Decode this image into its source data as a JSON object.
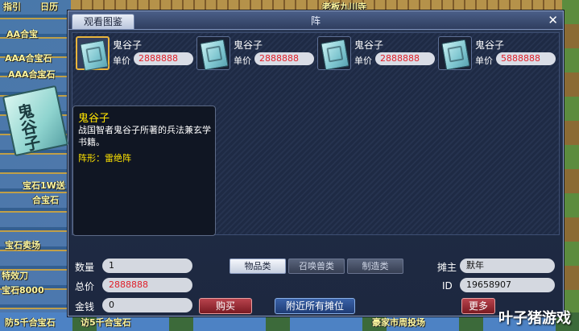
{
  "background": {
    "left_labels": [
      "指引",
      "日历",
      "AA合宝",
      "AAA合宝石",
      "AAA合宝石",
      "宝石1W送",
      "合宝石",
      "宝石卖场",
      "特效刀",
      "宝石8000",
      "防5千合宝石"
    ],
    "top_labels": [
      "老板九川寺"
    ],
    "bottom_labels": [
      "访5千合宝石",
      "豪家市周投场"
    ]
  },
  "window": {
    "tab_label": "观看图鉴",
    "title": "阵",
    "close_icon": "✕"
  },
  "items": [
    {
      "name": "鬼谷子",
      "price_label": "单价",
      "price": "2888888",
      "selected": true
    },
    {
      "name": "鬼谷子",
      "price_label": "单价",
      "price": "2888888",
      "selected": false
    },
    {
      "name": "鬼谷子",
      "price_label": "单价",
      "price": "2888888",
      "selected": false
    },
    {
      "name": "鬼谷子",
      "price_label": "单价",
      "price": "5888888",
      "selected": false
    }
  ],
  "tooltip": {
    "name": "鬼谷子",
    "description": "战国智者鬼谷子所著的兵法兼玄学书籍。",
    "formation": "阵形：雷绝阵",
    "icon_text": "鬼谷子"
  },
  "form": {
    "quantity_label": "数量",
    "quantity_value": "1",
    "total_label": "总价",
    "total_value": "2888888",
    "money_label": "金钱",
    "money_value": "0",
    "buy_button": "购买",
    "nearby_button": "附近所有摊位",
    "more_button": "更多",
    "seller_label": "摊主",
    "seller_value": "默年",
    "id_label": "ID",
    "id_value": "19658907"
  },
  "category_tabs": [
    "物品类",
    "召唤兽类",
    "制造类"
  ],
  "watermark": "叶子猪游戏",
  "colors": {
    "price_red": "#e0202a",
    "tooltip_yellow": "#ffe400",
    "window_bg": "#1f2b44"
  }
}
